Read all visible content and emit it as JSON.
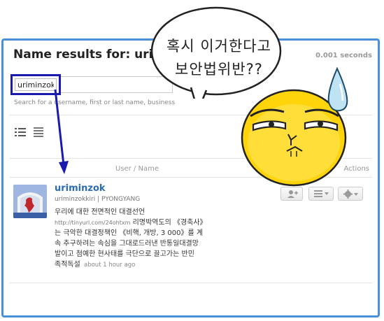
{
  "page": {
    "title": "Name results for: urimin",
    "timing": "0.001 seconds"
  },
  "search": {
    "value": "uriminzok",
    "hint": "Search for a username, first or last name, business"
  },
  "table": {
    "col_user": "User / Name",
    "col_actions": "Actions"
  },
  "result": {
    "name": "uriminzok",
    "handle": "uriminzokkiri | PYONGYANG",
    "tweet_lines": [
      "우리에 대한 전면적인 대결선언",
      "는 극악한 대결정책인 《비핵, 개방, 3 000》를 계",
      "속 추구하려는 속심을 그대로드러낸 반통일대결망",
      "발이고 첨예한 현사태를 극단으로 끌고가는 반민"
    ],
    "tweet_link": "http://tinyurl.com/24ohtxm",
    "tweet_link_suffix": " 리명박역도의 《경축사》",
    "tweet_last": "족적독설",
    "tweet_time": "about 1 hour ago"
  },
  "overlay": {
    "bubble_line1": "혹시 이거한다고",
    "bubble_line2": "보안법위반??"
  },
  "colors": {
    "frame": "#4a90d9",
    "highlight": "#1a1ab0",
    "link": "#2a6cb1",
    "emoji_face": "#ffd40a"
  },
  "icons": [
    "list-view-icon",
    "compact-view-icon",
    "follow-icon",
    "list-add-icon",
    "gear-icon",
    "arrow-icon",
    "sweat-drop-icon"
  ]
}
